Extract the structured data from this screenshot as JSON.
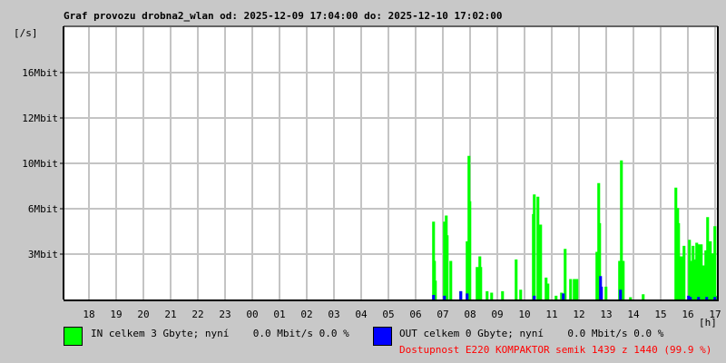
{
  "title": "Graf provozu drobna2_wlan od: 2025-12-09 17:04:00 do: 2025-12-10 17:02:00",
  "chart_data": {
    "type": "line",
    "title": "Graf provozu drobna2_wlan od: 2025-12-09 17:04:00 do: 2025-12-10 17:02:00",
    "ylabel": "[/s]",
    "xlabel": "[h]",
    "x_unit": "hours since 2025-12-09 17:04",
    "xlim": [
      0,
      24
    ],
    "x_ticks": [
      {
        "t": 0.93,
        "label": "18"
      },
      {
        "t": 1.93,
        "label": "19"
      },
      {
        "t": 2.93,
        "label": "20"
      },
      {
        "t": 3.93,
        "label": "21"
      },
      {
        "t": 4.93,
        "label": "22"
      },
      {
        "t": 5.93,
        "label": "23"
      },
      {
        "t": 6.93,
        "label": "00"
      },
      {
        "t": 7.93,
        "label": "01"
      },
      {
        "t": 8.93,
        "label": "02"
      },
      {
        "t": 9.93,
        "label": "03"
      },
      {
        "t": 10.93,
        "label": "04"
      },
      {
        "t": 11.93,
        "label": "05"
      },
      {
        "t": 12.93,
        "label": "06"
      },
      {
        "t": 13.93,
        "label": "07"
      },
      {
        "t": 14.93,
        "label": "08"
      },
      {
        "t": 15.93,
        "label": "09"
      },
      {
        "t": 16.93,
        "label": "10"
      },
      {
        "t": 17.93,
        "label": "11"
      },
      {
        "t": 18.93,
        "label": "12"
      },
      {
        "t": 19.93,
        "label": "13"
      },
      {
        "t": 20.93,
        "label": "14"
      },
      {
        "t": 21.93,
        "label": "15"
      },
      {
        "t": 22.93,
        "label": "16"
      },
      {
        "t": 23.93,
        "label": "17"
      }
    ],
    "y_ticks": [
      {
        "value": 3,
        "label": "3Mbit"
      },
      {
        "value": 6,
        "label": "6Mbit"
      },
      {
        "value": 10,
        "label": "10Mbit"
      },
      {
        "value": 12,
        "label": "12Mbit"
      },
      {
        "value": 16,
        "label": "16Mbit"
      }
    ],
    "y_grid_steps": 6,
    "grid": true,
    "series": [
      {
        "name": "IN",
        "color": "#00ff00",
        "points": [
          [
            13.57,
            5.1
          ],
          [
            13.6,
            2.5
          ],
          [
            13.63,
            1.2
          ],
          [
            13.97,
            5.1
          ],
          [
            14.03,
            5.5
          ],
          [
            14.07,
            4.2
          ],
          [
            14.2,
            2.5
          ],
          [
            14.57,
            0.5
          ],
          [
            14.8,
            3.8
          ],
          [
            14.87,
            10.3
          ],
          [
            14.9,
            6.6
          ],
          [
            15.17,
            2.1
          ],
          [
            15.27,
            2.8
          ],
          [
            15.3,
            2.1
          ],
          [
            15.53,
            0.5
          ],
          [
            15.7,
            0.4
          ],
          [
            16.1,
            0.5
          ],
          [
            16.6,
            2.6
          ],
          [
            16.77,
            0.6
          ],
          [
            17.23,
            5.6
          ],
          [
            17.27,
            7.2
          ],
          [
            17.4,
            7.0
          ],
          [
            17.43,
            3.4
          ],
          [
            17.5,
            4.9
          ],
          [
            17.7,
            1.4
          ],
          [
            17.77,
            1.0
          ],
          [
            18.07,
            0.2
          ],
          [
            18.27,
            0.4
          ],
          [
            18.4,
            3.3
          ],
          [
            18.6,
            1.3
          ],
          [
            18.73,
            1.3
          ],
          [
            18.83,
            1.3
          ],
          [
            19.57,
            3.1
          ],
          [
            19.63,
            8.2
          ],
          [
            19.67,
            5.0
          ],
          [
            19.9,
            0.8
          ],
          [
            20.4,
            2.5
          ],
          [
            20.47,
            10.1
          ],
          [
            20.53,
            2.5
          ],
          [
            20.8,
            0.1
          ],
          [
            21.27,
            0.3
          ],
          [
            22.47,
            7.8
          ],
          [
            22.53,
            6.0
          ],
          [
            22.57,
            5.0
          ],
          [
            22.67,
            2.8
          ],
          [
            22.77,
            3.5
          ],
          [
            22.97,
            3.9
          ],
          [
            23.03,
            2.5
          ],
          [
            23.1,
            3.5
          ],
          [
            23.17,
            2.6
          ],
          [
            23.23,
            3.7
          ],
          [
            23.3,
            2.0
          ],
          [
            23.33,
            3.6
          ],
          [
            23.4,
            3.6
          ],
          [
            23.47,
            2.2
          ],
          [
            23.5,
            0.6
          ],
          [
            23.57,
            3.2
          ],
          [
            23.63,
            5.4
          ],
          [
            23.67,
            2.8
          ],
          [
            23.73,
            3.8
          ],
          [
            23.8,
            3.0
          ],
          [
            23.87,
            3.0
          ],
          [
            23.9,
            4.8
          ],
          [
            23.97,
            0.2
          ]
        ]
      },
      {
        "name": "OUT",
        "color": "#0000ff",
        "points": [
          [
            13.57,
            0.25
          ],
          [
            13.97,
            0.2
          ],
          [
            14.57,
            0.5
          ],
          [
            14.8,
            0.35
          ],
          [
            17.27,
            0.2
          ],
          [
            18.33,
            0.35
          ],
          [
            19.7,
            1.5
          ],
          [
            19.73,
            0.8
          ],
          [
            20.43,
            0.6
          ],
          [
            22.93,
            0.2
          ],
          [
            23.0,
            0.12
          ],
          [
            23.3,
            0.12
          ],
          [
            23.6,
            0.12
          ],
          [
            23.9,
            0.12
          ]
        ]
      }
    ]
  },
  "legend": {
    "in_text": "IN celkem 3 Gbyte; nyní    0.0 Mbit/s 0.0 %",
    "out_text": "OUT celkem 0 Gbyte; nyní    0.0 Mbit/s 0.0 %",
    "availability": "Dostupnost E220 KOMPAKTOR semik 1439 z 1440 (99.9 %)"
  }
}
